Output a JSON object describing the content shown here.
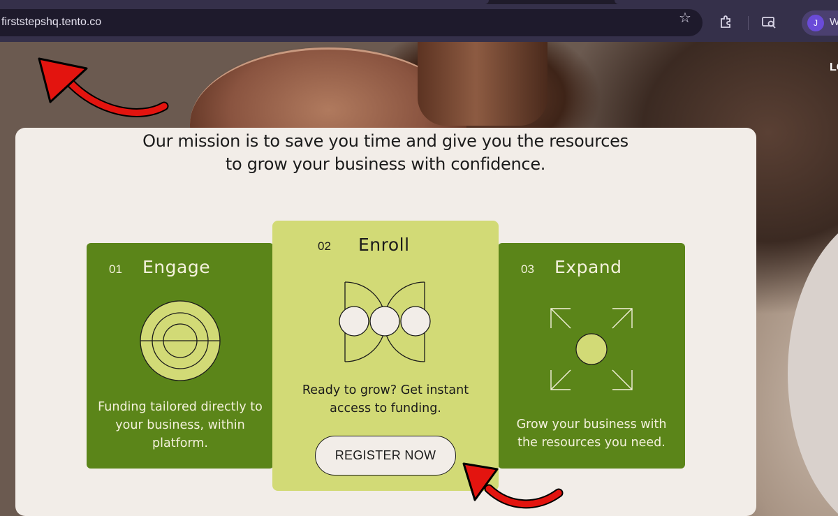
{
  "browser": {
    "url": "firststepshq.tento.co",
    "profile_initial": "J",
    "profile_name": "W",
    "icons": [
      "bookmark-star-icon",
      "extensions-icon",
      "reading-list-icon"
    ]
  },
  "nav": {
    "login_label": "LO"
  },
  "mission": {
    "text": "Our mission is to save you time and give you the resources to grow your business with confidence."
  },
  "steps": [
    {
      "number": "01",
      "title": "Engage",
      "description": "Funding tailored directly to your business, within platform.",
      "icon": "target-rings-icon"
    },
    {
      "number": "02",
      "title": "Enroll",
      "description": "Ready to grow? Get instant access to funding.",
      "icon": "three-circles-bowtie-icon",
      "cta": "REGISTER NOW"
    },
    {
      "number": "03",
      "title": "Expand",
      "description": "Grow your business with the resources you need.",
      "icon": "expand-arrows-icon"
    }
  ],
  "colors": {
    "step_dark_green": "#5b8519",
    "step_light_green": "#d2da76",
    "card_bg": "#f2ede8",
    "annotation_red": "#e3140f"
  }
}
